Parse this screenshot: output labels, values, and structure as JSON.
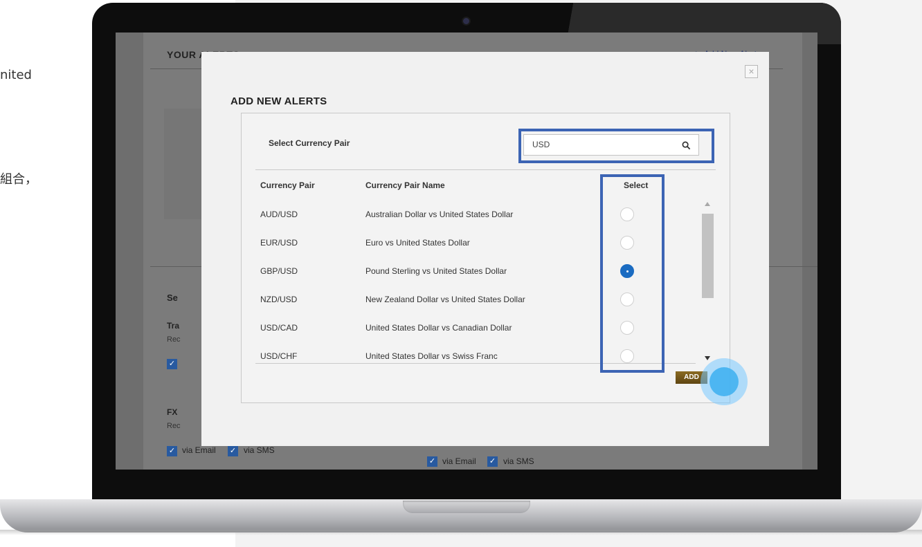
{
  "side_text": {
    "line1": "nited",
    "line2": "組合，"
  },
  "background_page": {
    "title": "YOUR ALERTS",
    "add_link": "▶  Add New Alerts",
    "section_s": "Se",
    "section_tra": "Tra",
    "section_rec1": "Rec",
    "section_fx": "FX",
    "section_rec2": "Rec",
    "via_email": "via Email",
    "via_sms": "via SMS"
  },
  "modal": {
    "title": "ADD NEW ALERTS",
    "close_label": "×",
    "select_label": "Select Currency Pair",
    "search_value": "USD",
    "columns": {
      "pair": "Currency Pair",
      "name": "Currency Pair Name",
      "select": "Select"
    },
    "rows": [
      {
        "pair": "AUD/USD",
        "name": "Australian Dollar vs United States Dollar",
        "selected": false
      },
      {
        "pair": "EUR/USD",
        "name": "Euro vs United States Dollar",
        "selected": false
      },
      {
        "pair": "GBP/USD",
        "name": "Pound Sterling vs United States Dollar",
        "selected": true
      },
      {
        "pair": "NZD/USD",
        "name": "New Zealand Dollar vs United States Dollar",
        "selected": false
      },
      {
        "pair": "USD/CAD",
        "name": "United States Dollar vs Canadian Dollar",
        "selected": false
      },
      {
        "pair": "USD/CHF",
        "name": "United States Dollar vs Swiss Franc",
        "selected": false
      }
    ],
    "add_label": "ADD"
  },
  "colors": {
    "highlight": "#3c64b4",
    "radio_selected": "#1a6bc1",
    "add_button": "#7a5c1c",
    "pointer": "#3cb0f0"
  }
}
